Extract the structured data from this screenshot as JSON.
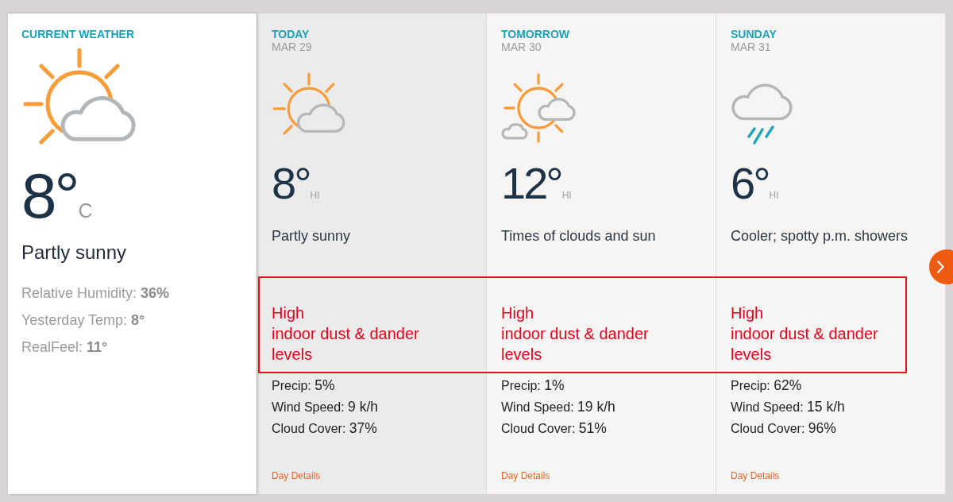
{
  "current": {
    "heading": "CURRENT WEATHER",
    "kind": "partly_sunny",
    "temp": "8°",
    "unit": "C",
    "condition": "Partly sunny",
    "stats": [
      {
        "label": "Relative Humidity:",
        "value": "36%"
      },
      {
        "label": "Yesterday Temp:",
        "value": "8°"
      },
      {
        "label": "RealFeel:",
        "value": "11°"
      }
    ]
  },
  "days": [
    {
      "day": "TODAY",
      "date": "MAR 29",
      "selected": true,
      "kind": "partly_sunny",
      "temp": "8°",
      "temp_label": "HI",
      "condition": "Partly sunny",
      "alert": [
        "High",
        "indoor dust & dander",
        "levels"
      ],
      "details": [
        {
          "label": "Precip:",
          "value": "5%"
        },
        {
          "label": "Wind Speed:",
          "value": "9 k/h"
        },
        {
          "label": "Cloud Cover:",
          "value": "37%"
        }
      ],
      "link": "Day Details"
    },
    {
      "day": "TOMORROW",
      "date": "MAR 30",
      "selected": false,
      "kind": "sun_clouds",
      "temp": "12°",
      "temp_label": "HI",
      "condition": "Times of clouds and sun",
      "alert": [
        "High",
        "indoor dust & dander",
        "levels"
      ],
      "details": [
        {
          "label": "Precip:",
          "value": "1%"
        },
        {
          "label": "Wind Speed:",
          "value": "19 k/h"
        },
        {
          "label": "Cloud Cover:",
          "value": "51%"
        }
      ],
      "link": "Day Details"
    },
    {
      "day": "SUNDAY",
      "date": "MAR 31",
      "selected": false,
      "kind": "showers",
      "temp": "6°",
      "temp_label": "HI",
      "condition": "Cooler; spotty p.m. showers",
      "alert": [
        "High",
        "indoor dust & dander",
        "levels"
      ],
      "details": [
        {
          "label": "Precip:",
          "value": "62%"
        },
        {
          "label": "Wind Speed:",
          "value": "15 k/h"
        },
        {
          "label": "Cloud Cover:",
          "value": "96%"
        }
      ],
      "link": "Day Details"
    }
  ],
  "highlight": {
    "kind": "frame"
  }
}
